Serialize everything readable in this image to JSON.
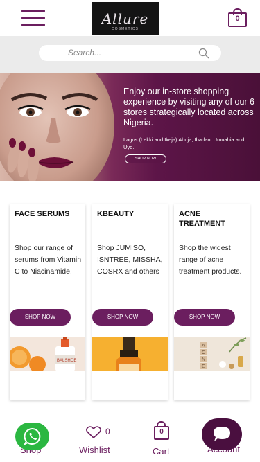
{
  "header": {
    "logo_text": "Allure",
    "logo_sub": "COSMETICS",
    "cart_count": "0"
  },
  "search": {
    "placeholder": "Search..."
  },
  "hero": {
    "headline": "Enjoy our in-store shopping experience by visiting any of our 6 stores strategically located across Nigeria.",
    "locations": "Lagos (Lekki and Ikeja) Abuja, Ibadan, Umuahia and Uyo.",
    "button_label": "SHOP NOW"
  },
  "cards": [
    {
      "title": "FACE SERUMS",
      "description": "Shop our range of serums from Vitamin C to Niacinamide.",
      "button_label": "SHOP NOW"
    },
    {
      "title": "KBEAUTY",
      "description": "Shop JUMISO, ISNTREE, MISSHA, COSRX and others",
      "button_label": "SHOP NOW"
    },
    {
      "title": "ACNE TREATMENT",
      "description": "Shop the widest range of acne treatment products.",
      "button_label": "SHOP NOW"
    }
  ],
  "bottom_nav": {
    "shop_label": "Shop",
    "wishlist_label": "Wishlist",
    "wishlist_count": "0",
    "cart_label": "Cart",
    "cart_count": "0",
    "account_label": "Account"
  },
  "colors": {
    "brand": "#6b1e5f",
    "whatsapp": "#2bb741",
    "chat": "#4a0f3f"
  }
}
